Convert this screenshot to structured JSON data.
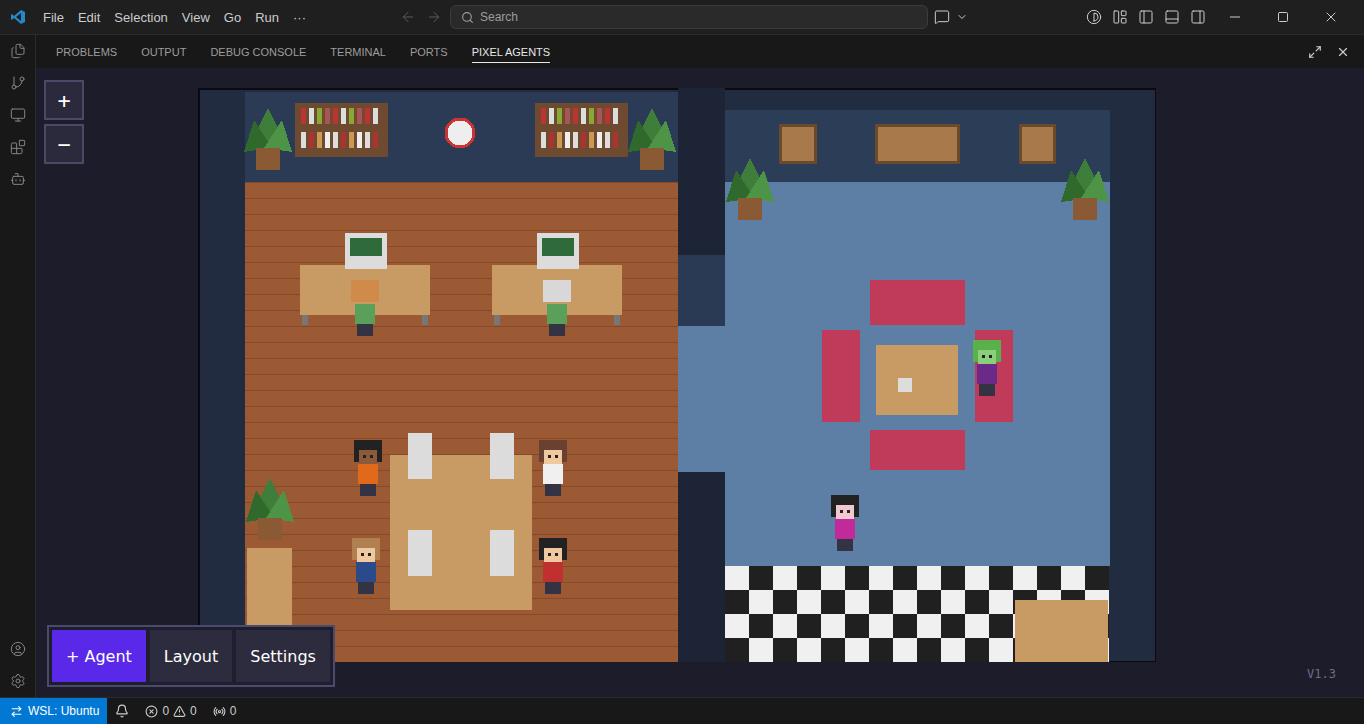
{
  "window": {
    "menu": [
      "File",
      "Edit",
      "Selection",
      "View",
      "Go",
      "Run",
      "···"
    ],
    "search": {
      "placeholder": "Search"
    }
  },
  "panel": {
    "tabs": [
      {
        "label": "PROBLEMS",
        "selected": false
      },
      {
        "label": "OUTPUT",
        "selected": false
      },
      {
        "label": "DEBUG CONSOLE",
        "selected": false
      },
      {
        "label": "TERMINAL",
        "selected": false
      },
      {
        "label": "PORTS",
        "selected": false
      },
      {
        "label": "PIXEL AGENTS",
        "selected": true
      }
    ]
  },
  "game": {
    "zoom_buttons": [
      "+",
      "−"
    ],
    "toolbar": [
      {
        "label": "+ Agent",
        "primary": true
      },
      {
        "label": "Layout",
        "primary": false
      },
      {
        "label": "Settings",
        "primary": false
      }
    ],
    "version": "V1.3"
  },
  "status_bar": {
    "remote": "WSL: Ubuntu",
    "errors": "0",
    "warnings": "0",
    "ports": "0"
  }
}
